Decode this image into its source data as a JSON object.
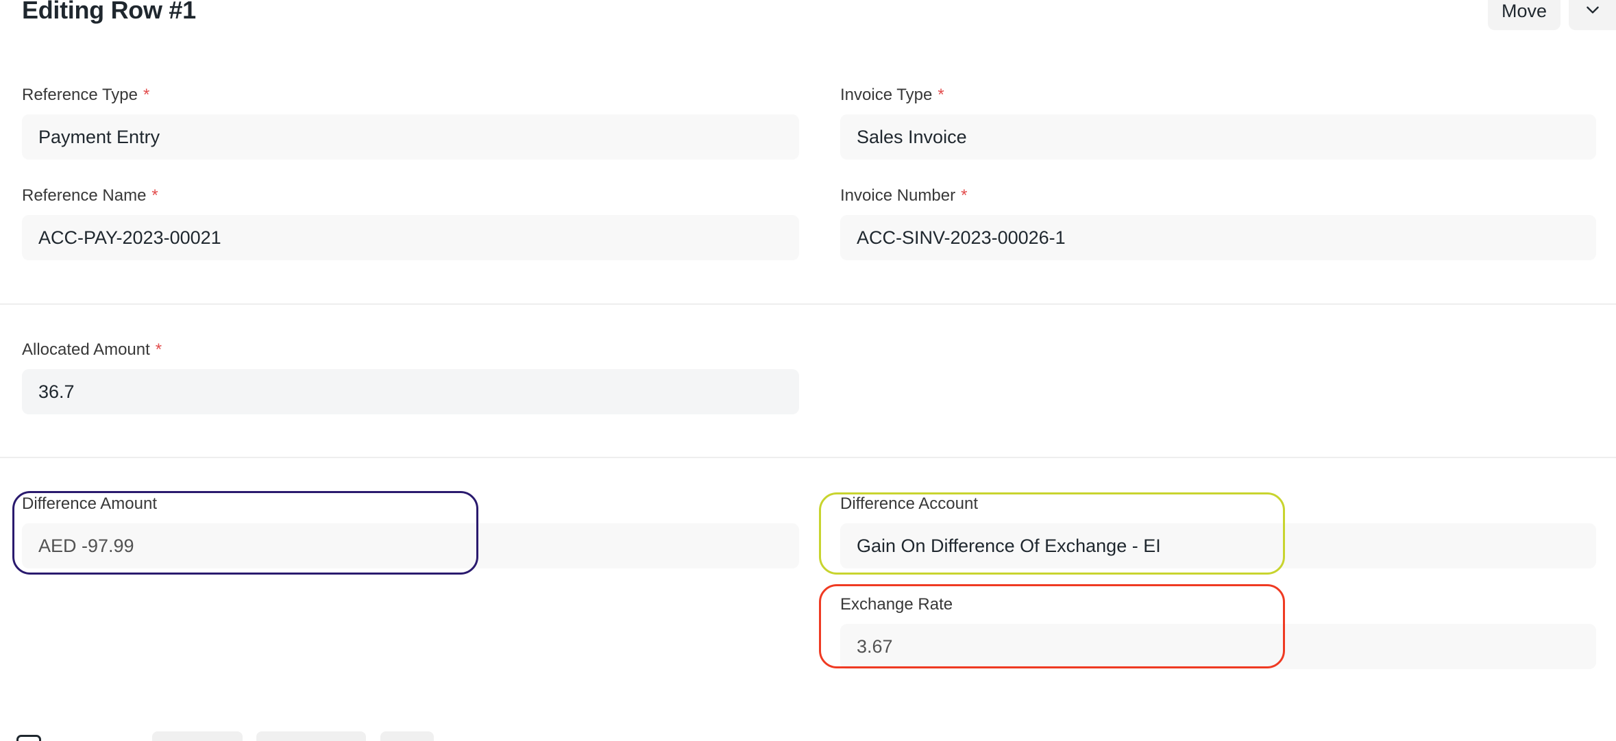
{
  "header": {
    "title": "Editing Row #1",
    "move_label": "Move",
    "collapse_icon": "chevron-down-icon"
  },
  "fields": {
    "reference_type": {
      "label": "Reference Type",
      "required": "*",
      "value": "Payment Entry"
    },
    "invoice_type": {
      "label": "Invoice Type",
      "required": "*",
      "value": "Sales Invoice"
    },
    "reference_name": {
      "label": "Reference Name",
      "required": "*",
      "value": "ACC-PAY-2023-00021"
    },
    "invoice_number": {
      "label": "Invoice Number",
      "required": "*",
      "value": "ACC-SINV-2023-00026-1"
    },
    "allocated_amount": {
      "label": "Allocated Amount",
      "required": "*",
      "value": "36.7"
    },
    "difference_amount": {
      "label": "Difference Amount",
      "value": "AED -97.99"
    },
    "difference_account": {
      "label": "Difference Account",
      "value": "Gain On Difference Of Exchange - EI"
    },
    "exchange_rate": {
      "label": "Exchange Rate",
      "value": "3.67"
    }
  },
  "highlight_colors": {
    "difference_amount": "#2a1a6e",
    "difference_account": "#c8d42e",
    "exchange_rate": "#ef3a22"
  },
  "colors": {
    "required_marker": "#e24c4c",
    "field_background": "#f8f8f8"
  }
}
